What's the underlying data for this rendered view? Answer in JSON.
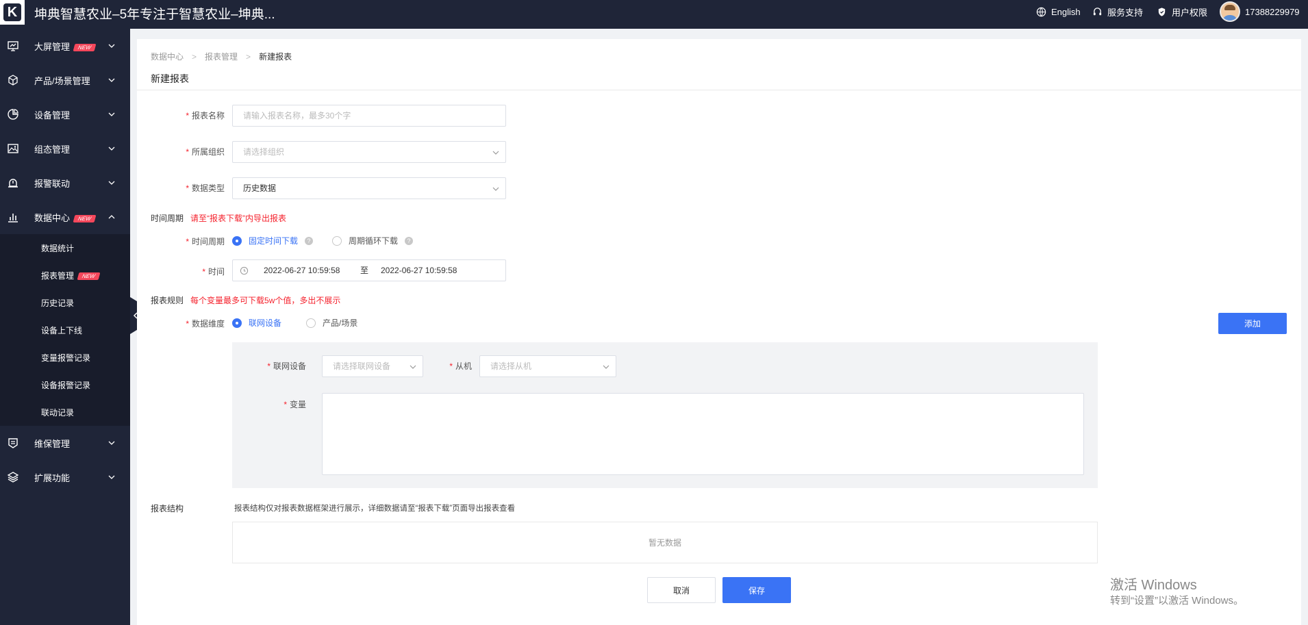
{
  "app": {
    "title": "坤典智慧农业–5年专注于智慧农业–坤典...",
    "logo_letter": "K"
  },
  "topbar": {
    "language": "English",
    "service": "服务支持",
    "permissions": "用户权限",
    "user_phone": "17388229979"
  },
  "sidebar": {
    "items": [
      {
        "label": "大屏管理",
        "badge": "NEW",
        "icon": "monitor-icon"
      },
      {
        "label": "产品/场景管理",
        "icon": "cube-icon"
      },
      {
        "label": "设备管理",
        "icon": "pie-icon"
      },
      {
        "label": "组态管理",
        "icon": "image-icon"
      },
      {
        "label": "报警联动",
        "icon": "alarm-icon"
      },
      {
        "label": "数据中心",
        "badge": "NEW",
        "icon": "bar-chart-icon"
      },
      {
        "label": "维保管理",
        "icon": "maintenance-icon"
      },
      {
        "label": "扩展功能",
        "icon": "layers-icon"
      }
    ],
    "sub_items": [
      {
        "label": "数据统计"
      },
      {
        "label": "报表管理",
        "badge": "NEW"
      },
      {
        "label": "历史记录"
      },
      {
        "label": "设备上下线"
      },
      {
        "label": "变量报警记录"
      },
      {
        "label": "设备报警记录"
      },
      {
        "label": "联动记录"
      }
    ]
  },
  "breadcrumb": [
    "数据中心",
    "报表管理",
    "新建报表"
  ],
  "page_title": "新建报表",
  "form": {
    "report_name": {
      "label": "报表名称",
      "placeholder": "请输入报表名称，最多30个字"
    },
    "org": {
      "label": "所属组织",
      "placeholder": "请选择组织"
    },
    "data_type": {
      "label": "数据类型",
      "value": "历史数据"
    },
    "time_section": {
      "title": "时间周期",
      "warning": "请至“报表下载”内导出报表"
    },
    "time_period": {
      "label": "时间周期",
      "option_fixed": "固定时间下载",
      "option_cycle": "周期循环下载"
    },
    "time": {
      "label": "时间",
      "start": "2022-06-27 10:59:58",
      "to": "至",
      "end": "2022-06-27 10:59:58"
    },
    "rules_section": {
      "title": "报表规则",
      "warning": "每个变量最多可下载5w个值，多出不展示"
    },
    "dimension": {
      "label": "数据维度",
      "option_device": "联网设备",
      "option_product": "产品/场景"
    },
    "add_button": "添加",
    "device": {
      "label": "联网设备",
      "placeholder": "请选择联网设备"
    },
    "slave": {
      "label": "从机",
      "placeholder": "请选择从机"
    },
    "variable": {
      "label": "变量"
    },
    "structure": {
      "title": "报表结构",
      "hint": "报表结构仅对报表数据框架进行展示，详细数据请至“报表下载”页面导出报表查看",
      "empty": "暂无数据"
    },
    "cancel": "取消",
    "save": "保存"
  },
  "watermark": {
    "line1": "激活 Windows",
    "line2": "转到“设置”以激活 Windows。"
  },
  "colors": {
    "primary": "#3a73f5",
    "sidebar": "#1f2538",
    "required": "#f5222d",
    "badge": "#f5475b"
  }
}
